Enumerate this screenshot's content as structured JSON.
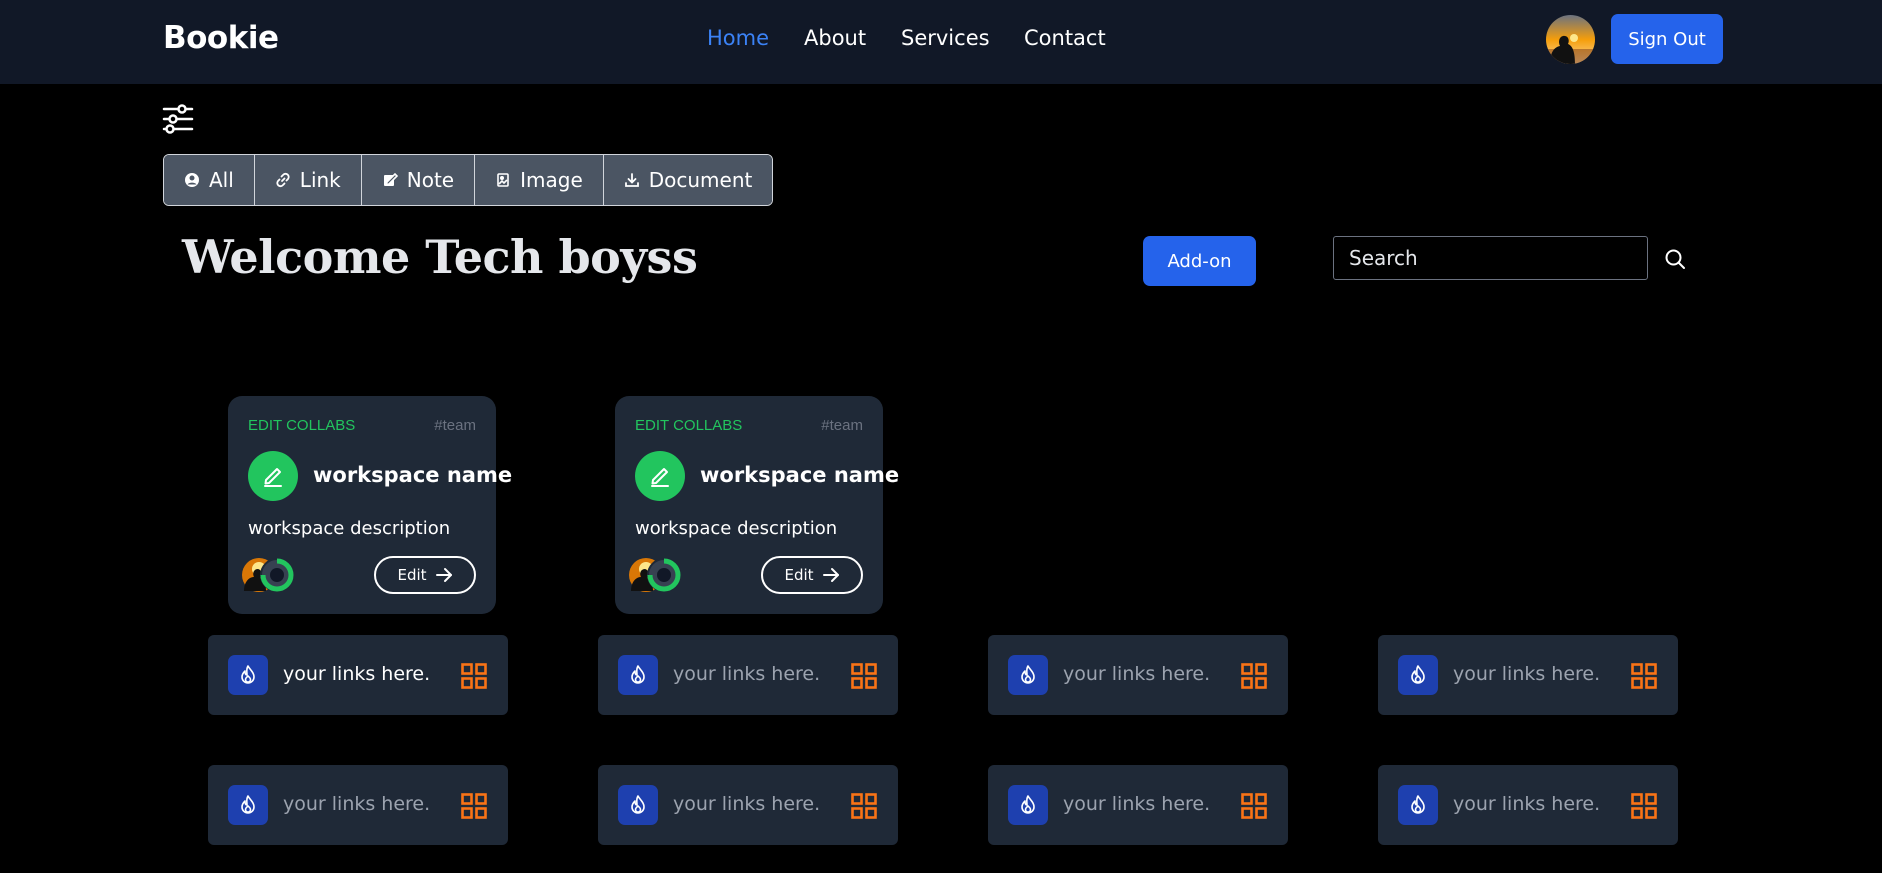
{
  "header": {
    "brand": "Bookie",
    "nav": [
      {
        "label": "Home",
        "active": true
      },
      {
        "label": "About",
        "active": false
      },
      {
        "label": "Services",
        "active": false
      },
      {
        "label": "Contact",
        "active": false
      }
    ],
    "signout_label": "Sign Out"
  },
  "filters": [
    {
      "label": "All",
      "icon": "user-circle-icon"
    },
    {
      "label": "Link",
      "icon": "link-icon"
    },
    {
      "label": "Note",
      "icon": "note-icon"
    },
    {
      "label": "Image",
      "icon": "image-icon"
    },
    {
      "label": "Document",
      "icon": "download-icon"
    }
  ],
  "main": {
    "welcome": "Welcome Tech boyss",
    "addon_label": "Add-on",
    "search_placeholder": "Search"
  },
  "workspaces": [
    {
      "tag": "EDIT COLLABS",
      "team": "#team",
      "name": "workspace name",
      "description": "workspace description",
      "edit_label": "Edit"
    },
    {
      "tag": "EDIT COLLABS",
      "team": "#team",
      "name": "workspace name",
      "description": "workspace description",
      "edit_label": "Edit"
    }
  ],
  "links": [
    {
      "text": "your links here."
    },
    {
      "text": "your links here."
    },
    {
      "text": "your links here."
    },
    {
      "text": "your links here."
    },
    {
      "text": "your links here."
    },
    {
      "text": "your links here."
    },
    {
      "text": "your links here."
    },
    {
      "text": "your links here."
    }
  ],
  "colors": {
    "accent": "#2563eb",
    "nav_active": "#3b82f6",
    "green": "#22c55e",
    "orange": "#f97316",
    "card_bg": "#1f2937",
    "header_bg": "#111827"
  }
}
